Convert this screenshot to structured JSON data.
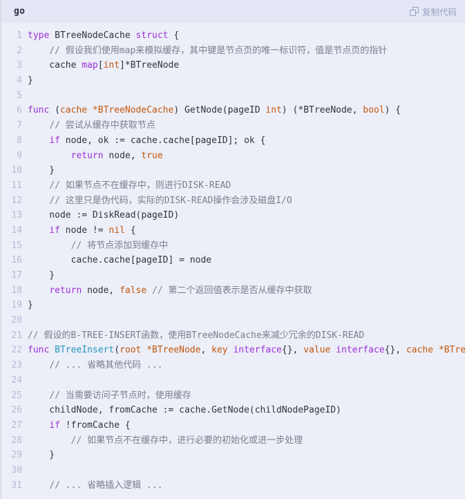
{
  "header": {
    "language": "go",
    "copy_label": "复制代码",
    "copy_icon": "copy-icon"
  },
  "theme": {
    "background": "#eceef8",
    "header_background": "#e4e7f5",
    "keyword": "#9b30d9",
    "type": "#c2570b",
    "function": "#2596be",
    "comment": "#7a7f8c",
    "text": "#30323d",
    "line_number": "#b6bbd4"
  },
  "code": {
    "line_count": 31,
    "lines": [
      {
        "n": "1",
        "tokens": [
          {
            "t": "kw",
            "v": "type"
          },
          {
            "t": "txt",
            "v": " BTreeNodeCache "
          },
          {
            "t": "kw",
            "v": "struct"
          },
          {
            "t": "txt",
            "v": " {"
          }
        ]
      },
      {
        "n": "2",
        "tokens": [
          {
            "t": "txt",
            "v": "    "
          },
          {
            "t": "cmt",
            "v": "// 假设我们使用map来模拟缓存，其中键是节点页的唯一标识符，值是节点页的指针"
          }
        ]
      },
      {
        "n": "3",
        "tokens": [
          {
            "t": "txt",
            "v": "    cache "
          },
          {
            "t": "kw",
            "v": "map"
          },
          {
            "t": "txt",
            "v": "["
          },
          {
            "t": "typ",
            "v": "int"
          },
          {
            "t": "txt",
            "v": "]*BTreeNode"
          }
        ]
      },
      {
        "n": "4",
        "tokens": [
          {
            "t": "txt",
            "v": "}"
          }
        ]
      },
      {
        "n": "5",
        "tokens": []
      },
      {
        "n": "6",
        "tokens": [
          {
            "t": "kw",
            "v": "func"
          },
          {
            "t": "txt",
            "v": " ("
          },
          {
            "t": "typ",
            "v": "cache *BTreeNodeCache"
          },
          {
            "t": "txt",
            "v": ") GetNode(pageID "
          },
          {
            "t": "typ",
            "v": "int"
          },
          {
            "t": "txt",
            "v": ") (*BTreeNode, "
          },
          {
            "t": "typ",
            "v": "bool"
          },
          {
            "t": "txt",
            "v": ") {"
          }
        ]
      },
      {
        "n": "7",
        "tokens": [
          {
            "t": "txt",
            "v": "    "
          },
          {
            "t": "cmt",
            "v": "// 尝试从缓存中获取节点"
          }
        ]
      },
      {
        "n": "8",
        "tokens": [
          {
            "t": "txt",
            "v": "    "
          },
          {
            "t": "kw",
            "v": "if"
          },
          {
            "t": "txt",
            "v": " node, ok := cache.cache[pageID]; ok {"
          }
        ]
      },
      {
        "n": "9",
        "tokens": [
          {
            "t": "txt",
            "v": "        "
          },
          {
            "t": "kw",
            "v": "return"
          },
          {
            "t": "txt",
            "v": " node, "
          },
          {
            "t": "typ",
            "v": "true"
          }
        ]
      },
      {
        "n": "10",
        "tokens": [
          {
            "t": "txt",
            "v": "    }"
          }
        ]
      },
      {
        "n": "11",
        "tokens": [
          {
            "t": "txt",
            "v": "    "
          },
          {
            "t": "cmt",
            "v": "// 如果节点不在缓存中，则进行DISK-READ"
          }
        ]
      },
      {
        "n": "12",
        "tokens": [
          {
            "t": "txt",
            "v": "    "
          },
          {
            "t": "cmt",
            "v": "// 这里只是伪代码，实际的DISK-READ操作会涉及磁盘I/O"
          }
        ]
      },
      {
        "n": "13",
        "tokens": [
          {
            "t": "txt",
            "v": "    node := DiskRead(pageID)"
          }
        ]
      },
      {
        "n": "14",
        "tokens": [
          {
            "t": "txt",
            "v": "    "
          },
          {
            "t": "kw",
            "v": "if"
          },
          {
            "t": "txt",
            "v": " node != "
          },
          {
            "t": "typ",
            "v": "nil"
          },
          {
            "t": "txt",
            "v": " {"
          }
        ]
      },
      {
        "n": "15",
        "tokens": [
          {
            "t": "txt",
            "v": "        "
          },
          {
            "t": "cmt",
            "v": "// 将节点添加到缓存中"
          }
        ]
      },
      {
        "n": "16",
        "tokens": [
          {
            "t": "txt",
            "v": "        cache.cache[pageID] = node"
          }
        ]
      },
      {
        "n": "17",
        "tokens": [
          {
            "t": "txt",
            "v": "    }"
          }
        ]
      },
      {
        "n": "18",
        "tokens": [
          {
            "t": "txt",
            "v": "    "
          },
          {
            "t": "kw",
            "v": "return"
          },
          {
            "t": "txt",
            "v": " node, "
          },
          {
            "t": "typ",
            "v": "false"
          },
          {
            "t": "txt",
            "v": " "
          },
          {
            "t": "cmt",
            "v": "// 第二个返回值表示是否从缓存中获取"
          }
        ]
      },
      {
        "n": "19",
        "tokens": [
          {
            "t": "txt",
            "v": "}"
          }
        ]
      },
      {
        "n": "20",
        "tokens": []
      },
      {
        "n": "21",
        "tokens": [
          {
            "t": "cmt",
            "v": "// 假设的B-TREE-INSERT函数，使用BTreeNodeCache来减少冗余的DISK-READ"
          }
        ]
      },
      {
        "n": "22",
        "tokens": [
          {
            "t": "kw",
            "v": "func"
          },
          {
            "t": "txt",
            "v": " "
          },
          {
            "t": "fn",
            "v": "BTreeInsert"
          },
          {
            "t": "txt",
            "v": "("
          },
          {
            "t": "typ",
            "v": "root *BTreeNode"
          },
          {
            "t": "txt",
            "v": ", "
          },
          {
            "t": "typ",
            "v": "key"
          },
          {
            "t": "txt",
            "v": " "
          },
          {
            "t": "kw",
            "v": "interface"
          },
          {
            "t": "txt",
            "v": "{}, "
          },
          {
            "t": "typ",
            "v": "value"
          },
          {
            "t": "txt",
            "v": " "
          },
          {
            "t": "kw",
            "v": "interface"
          },
          {
            "t": "txt",
            "v": "{}, "
          },
          {
            "t": "typ",
            "v": "cache *BTreeNodeCache"
          },
          {
            "t": "txt",
            "v": ") {"
          }
        ]
      },
      {
        "n": "23",
        "tokens": [
          {
            "t": "txt",
            "v": "    "
          },
          {
            "t": "cmt",
            "v": "// ... 省略其他代码 ..."
          }
        ]
      },
      {
        "n": "24",
        "tokens": []
      },
      {
        "n": "25",
        "tokens": [
          {
            "t": "txt",
            "v": "    "
          },
          {
            "t": "cmt",
            "v": "// 当需要访问子节点时，使用缓存"
          }
        ]
      },
      {
        "n": "26",
        "tokens": [
          {
            "t": "txt",
            "v": "    childNode, fromCache := cache.GetNode(childNodePageID)"
          }
        ]
      },
      {
        "n": "27",
        "tokens": [
          {
            "t": "txt",
            "v": "    "
          },
          {
            "t": "kw",
            "v": "if"
          },
          {
            "t": "txt",
            "v": " !fromCache {"
          }
        ]
      },
      {
        "n": "28",
        "tokens": [
          {
            "t": "txt",
            "v": "        "
          },
          {
            "t": "cmt",
            "v": "// 如果节点不在缓存中，进行必要的初始化或进一步处理"
          }
        ]
      },
      {
        "n": "29",
        "tokens": [
          {
            "t": "txt",
            "v": "    }"
          }
        ]
      },
      {
        "n": "30",
        "tokens": []
      },
      {
        "n": "31",
        "tokens": [
          {
            "t": "txt",
            "v": "    "
          },
          {
            "t": "cmt",
            "v": "// ... 省略插入逻辑 ..."
          }
        ]
      }
    ]
  }
}
